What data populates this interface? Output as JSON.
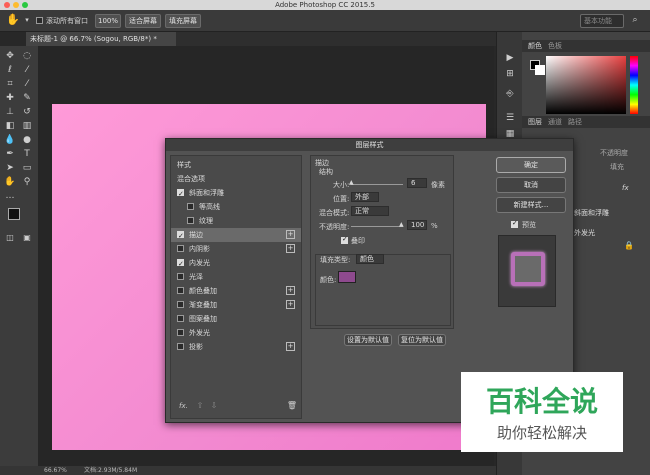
{
  "app": {
    "title": "Adobe Photoshop CC 2015.5"
  },
  "options_bar": {
    "scroll_all_label": "滚动所有窗口",
    "zoom_100": "100%",
    "fit_screen": "适合屏幕",
    "fill_screen": "填充屏幕",
    "workspace": "基本功能"
  },
  "document_tab": {
    "label": "未标题-1 @ 66.7% (Sogou, RGB/8*) *"
  },
  "status": {
    "zoom": "66.67%",
    "doc": "文档:2.93M/5.84M"
  },
  "right_panel": {
    "color_tab": "颜色",
    "swatch_tab": "色板",
    "layers_tab": "图层",
    "channels_tab": "通道",
    "paths_tab": "路径",
    "opacity_label": "不透明度",
    "fill_label": "填充",
    "fx": "fx",
    "layer_effects": [
      "斜面和浮雕",
      "外发光"
    ],
    "colors": {
      "accent": "#e84040"
    }
  },
  "dialog": {
    "title": "图层样式",
    "styles_header": "样式",
    "blend_options": "混合选项",
    "items": [
      {
        "label": "斜面和浮雕",
        "checked": true,
        "plus": false,
        "indent": false
      },
      {
        "label": "等高线",
        "checked": false,
        "plus": false,
        "indent": true
      },
      {
        "label": "纹理",
        "checked": false,
        "plus": false,
        "indent": true
      },
      {
        "label": "描边",
        "checked": true,
        "plus": true,
        "indent": false,
        "selected": true
      },
      {
        "label": "内阴影",
        "checked": false,
        "plus": true,
        "indent": false
      },
      {
        "label": "内发光",
        "checked": true,
        "plus": false,
        "indent": false
      },
      {
        "label": "光泽",
        "checked": false,
        "plus": false,
        "indent": false
      },
      {
        "label": "颜色叠加",
        "checked": false,
        "plus": true,
        "indent": false
      },
      {
        "label": "渐变叠加",
        "checked": false,
        "plus": true,
        "indent": false
      },
      {
        "label": "图案叠加",
        "checked": false,
        "plus": false,
        "indent": false
      },
      {
        "label": "外发光",
        "checked": false,
        "plus": false,
        "indent": false
      },
      {
        "label": "投影",
        "checked": false,
        "plus": true,
        "indent": false
      }
    ],
    "fx_label": "fx.",
    "stroke": {
      "section": "描边",
      "structure": "结构",
      "size_label": "大小:",
      "size_value": "6",
      "size_unit": "像素",
      "position_label": "位置:",
      "position_value": "外部",
      "blend_label": "混合模式:",
      "blend_value": "正常",
      "opacity_label": "不透明度:",
      "opacity_value": "100",
      "opacity_unit": "%",
      "overprint_label": "叠印",
      "fill_type_label": "填充类型:",
      "fill_type_value": "颜色",
      "color_label": "颜色:",
      "stroke_color": "#8e4a8e"
    },
    "set_default": "设置为默认值",
    "reset_default": "复位为默认值",
    "ok": "确定",
    "cancel": "取消",
    "new_style": "新建样式...",
    "preview": "预览"
  },
  "watermark": {
    "line1": "百科全说",
    "line2": "助你轻松解决"
  }
}
